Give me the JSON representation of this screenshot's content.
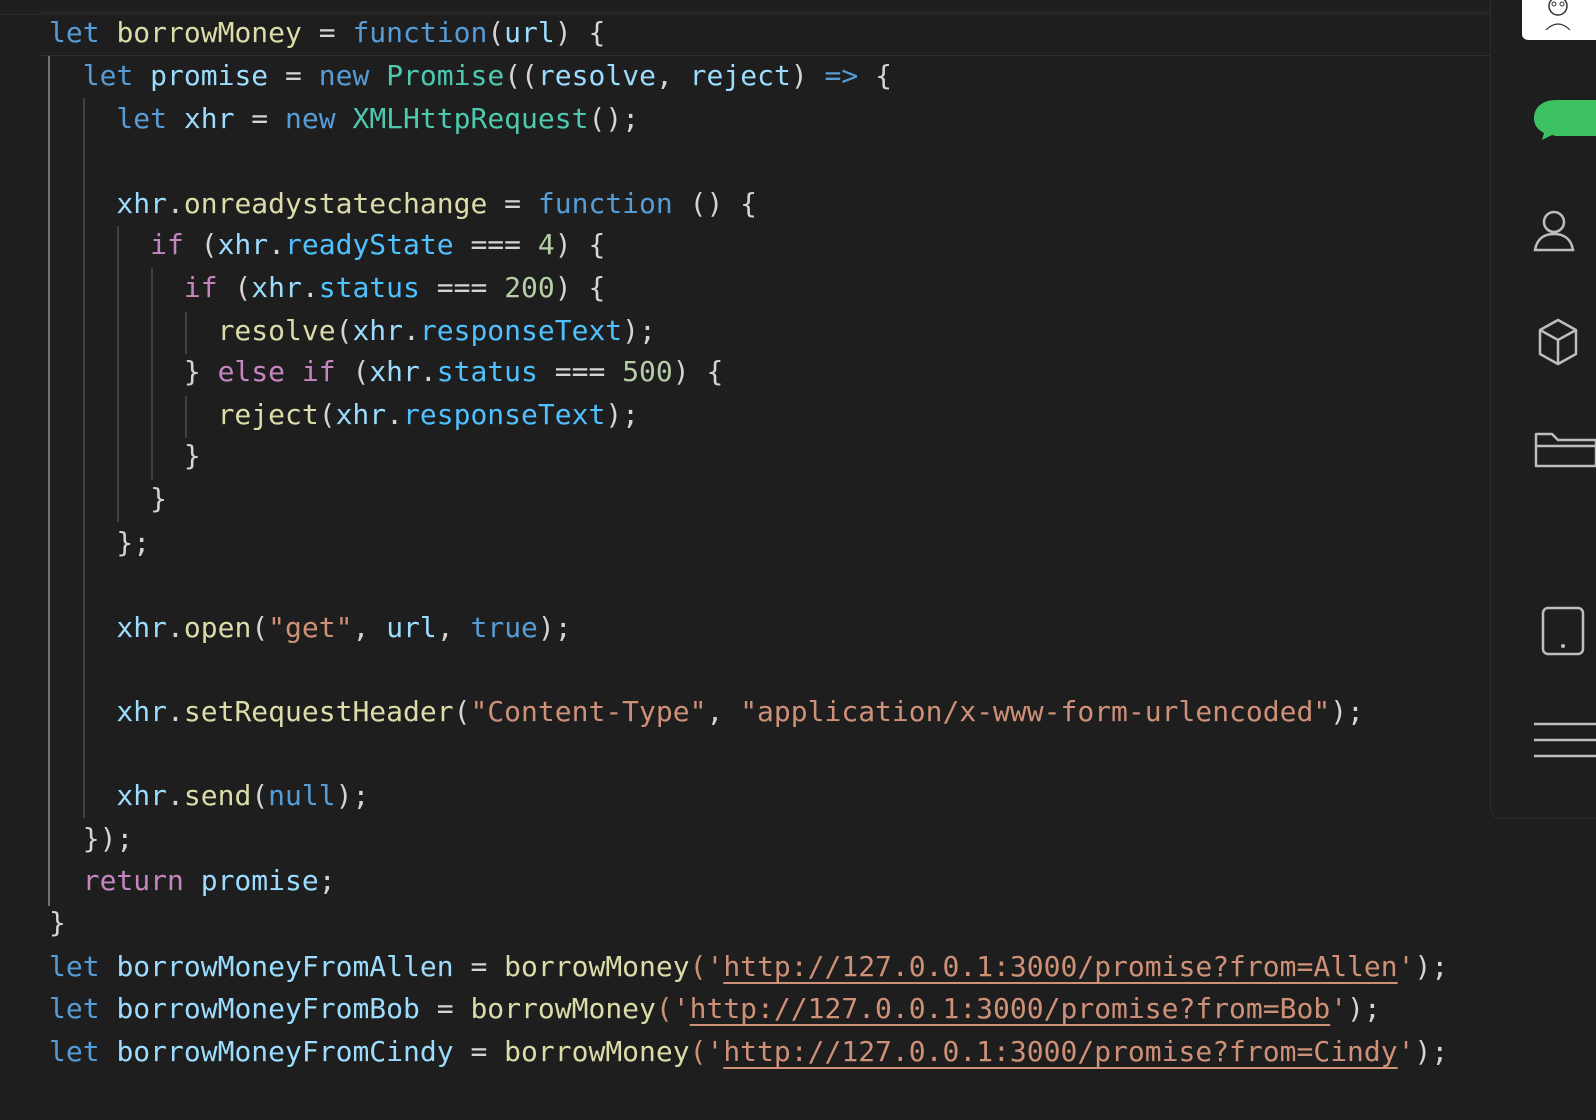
{
  "editor": {
    "lines": [
      [
        {
          "t": "let",
          "c": "kw"
        },
        {
          "t": " ",
          "c": "pun"
        },
        {
          "t": "borrowMoney",
          "c": "fn"
        },
        {
          "t": " = ",
          "c": "pun"
        },
        {
          "t": "function",
          "c": "kw"
        },
        {
          "t": "(",
          "c": "pun"
        },
        {
          "t": "url",
          "c": "var"
        },
        {
          "t": ") {",
          "c": "pun"
        }
      ],
      [
        {
          "t": "  let",
          "c": "kw"
        },
        {
          "t": " ",
          "c": "pun"
        },
        {
          "t": "promise",
          "c": "var"
        },
        {
          "t": " = ",
          "c": "pun"
        },
        {
          "t": "new",
          "c": "kw"
        },
        {
          "t": " ",
          "c": "pun"
        },
        {
          "t": "Promise",
          "c": "cls"
        },
        {
          "t": "((",
          "c": "pun"
        },
        {
          "t": "resolve",
          "c": "var"
        },
        {
          "t": ", ",
          "c": "pun"
        },
        {
          "t": "reject",
          "c": "var"
        },
        {
          "t": ") ",
          "c": "pun"
        },
        {
          "t": "=>",
          "c": "kw"
        },
        {
          "t": " {",
          "c": "pun"
        }
      ],
      [
        {
          "t": "    let",
          "c": "kw"
        },
        {
          "t": " ",
          "c": "pun"
        },
        {
          "t": "xhr",
          "c": "var"
        },
        {
          "t": " = ",
          "c": "pun"
        },
        {
          "t": "new",
          "c": "kw"
        },
        {
          "t": " ",
          "c": "pun"
        },
        {
          "t": "XMLHttpRequest",
          "c": "cls"
        },
        {
          "t": "();",
          "c": "pun"
        }
      ],
      [],
      [
        {
          "t": "    xhr",
          "c": "var"
        },
        {
          "t": ".",
          "c": "pun"
        },
        {
          "t": "onreadystatechange",
          "c": "fn"
        },
        {
          "t": " = ",
          "c": "pun"
        },
        {
          "t": "function",
          "c": "kw"
        },
        {
          "t": " () {",
          "c": "pun"
        }
      ],
      [
        {
          "t": "      if",
          "c": "ctrl"
        },
        {
          "t": " (",
          "c": "pun"
        },
        {
          "t": "xhr",
          "c": "var"
        },
        {
          "t": ".",
          "c": "pun"
        },
        {
          "t": "readyState",
          "c": "prop"
        },
        {
          "t": " === ",
          "c": "pun"
        },
        {
          "t": "4",
          "c": "num"
        },
        {
          "t": ") {",
          "c": "pun"
        }
      ],
      [
        {
          "t": "        if",
          "c": "ctrl"
        },
        {
          "t": " (",
          "c": "pun"
        },
        {
          "t": "xhr",
          "c": "var"
        },
        {
          "t": ".",
          "c": "pun"
        },
        {
          "t": "status",
          "c": "prop"
        },
        {
          "t": " === ",
          "c": "pun"
        },
        {
          "t": "200",
          "c": "num"
        },
        {
          "t": ") {",
          "c": "pun"
        }
      ],
      [
        {
          "t": "          resolve",
          "c": "fn"
        },
        {
          "t": "(",
          "c": "pun"
        },
        {
          "t": "xhr",
          "c": "var"
        },
        {
          "t": ".",
          "c": "pun"
        },
        {
          "t": "responseText",
          "c": "prop"
        },
        {
          "t": ");",
          "c": "pun"
        }
      ],
      [
        {
          "t": "        } ",
          "c": "pun"
        },
        {
          "t": "else",
          "c": "ctrl"
        },
        {
          "t": " ",
          "c": "pun"
        },
        {
          "t": "if",
          "c": "ctrl"
        },
        {
          "t": " (",
          "c": "pun"
        },
        {
          "t": "xhr",
          "c": "var"
        },
        {
          "t": ".",
          "c": "pun"
        },
        {
          "t": "status",
          "c": "prop"
        },
        {
          "t": " === ",
          "c": "pun"
        },
        {
          "t": "500",
          "c": "num"
        },
        {
          "t": ") {",
          "c": "pun"
        }
      ],
      [
        {
          "t": "          reject",
          "c": "fn"
        },
        {
          "t": "(",
          "c": "pun"
        },
        {
          "t": "xhr",
          "c": "var"
        },
        {
          "t": ".",
          "c": "pun"
        },
        {
          "t": "responseText",
          "c": "prop"
        },
        {
          "t": ");",
          "c": "pun"
        }
      ],
      [
        {
          "t": "        }",
          "c": "pun"
        }
      ],
      [
        {
          "t": "      }",
          "c": "pun"
        }
      ],
      [
        {
          "t": "    };",
          "c": "pun"
        }
      ],
      [],
      [
        {
          "t": "    xhr",
          "c": "var"
        },
        {
          "t": ".",
          "c": "pun"
        },
        {
          "t": "open",
          "c": "fn"
        },
        {
          "t": "(",
          "c": "pun"
        },
        {
          "t": "\"get\"",
          "c": "str"
        },
        {
          "t": ", ",
          "c": "pun"
        },
        {
          "t": "url",
          "c": "var"
        },
        {
          "t": ", ",
          "c": "pun"
        },
        {
          "t": "true",
          "c": "kw"
        },
        {
          "t": ");",
          "c": "pun"
        }
      ],
      [],
      [
        {
          "t": "    xhr",
          "c": "var"
        },
        {
          "t": ".",
          "c": "pun"
        },
        {
          "t": "setRequestHeader",
          "c": "fn"
        },
        {
          "t": "(",
          "c": "pun"
        },
        {
          "t": "\"Content-Type\"",
          "c": "str"
        },
        {
          "t": ", ",
          "c": "pun"
        },
        {
          "t": "\"application/x-www-form-urlencoded\"",
          "c": "str"
        },
        {
          "t": ");",
          "c": "pun"
        }
      ],
      [],
      [
        {
          "t": "    xhr",
          "c": "var"
        },
        {
          "t": ".",
          "c": "pun"
        },
        {
          "t": "send",
          "c": "fn"
        },
        {
          "t": "(",
          "c": "pun"
        },
        {
          "t": "null",
          "c": "kw"
        },
        {
          "t": ");",
          "c": "pun"
        }
      ],
      [
        {
          "t": "  });",
          "c": "pun"
        }
      ],
      [
        {
          "t": "  return",
          "c": "ctrl"
        },
        {
          "t": " ",
          "c": "pun"
        },
        {
          "t": "promise",
          "c": "var"
        },
        {
          "t": ";",
          "c": "pun"
        }
      ],
      [
        {
          "t": "}",
          "c": "pun"
        }
      ],
      [
        {
          "t": "let",
          "c": "kw"
        },
        {
          "t": " ",
          "c": "pun"
        },
        {
          "t": "borrowMoneyFromAllen",
          "c": "var"
        },
        {
          "t": " = ",
          "c": "pun"
        },
        {
          "t": "borrowMoney",
          "c": "fn"
        },
        {
          "t": "('",
          "c": "str"
        },
        {
          "t": "http://127.0.0.1:3000/promise?from=Allen",
          "c": "str link"
        },
        {
          "t": "'",
          "c": "str"
        },
        {
          "t": ");",
          "c": "pun"
        }
      ],
      [
        {
          "t": "let",
          "c": "kw"
        },
        {
          "t": " ",
          "c": "pun"
        },
        {
          "t": "borrowMoneyFromBob",
          "c": "var"
        },
        {
          "t": " = ",
          "c": "pun"
        },
        {
          "t": "borrowMoney",
          "c": "fn"
        },
        {
          "t": "('",
          "c": "str"
        },
        {
          "t": "http://127.0.0.1:3000/promise?from=Bob",
          "c": "str link"
        },
        {
          "t": "'",
          "c": "str"
        },
        {
          "t": ");",
          "c": "pun"
        }
      ],
      [
        {
          "t": "let",
          "c": "kw"
        },
        {
          "t": " ",
          "c": "pun"
        },
        {
          "t": "borrowMoneyFromCindy",
          "c": "var"
        },
        {
          "t": " = ",
          "c": "pun"
        },
        {
          "t": "borrowMoney",
          "c": "fn"
        },
        {
          "t": "('",
          "c": "str"
        },
        {
          "t": "http://127.0.0.1:3000/promise?from=Cindy",
          "c": "str link"
        },
        {
          "t": "'",
          "c": "str"
        },
        {
          "t": ");",
          "c": "pun"
        }
      ]
    ]
  },
  "right_panel": {
    "icons": [
      "avatar",
      "chat-icon",
      "contacts-icon",
      "box-icon",
      "folder-icon",
      "phone-icon",
      "menu-icon"
    ]
  },
  "colors": {
    "background": "#1e1e1e",
    "keyword": "#569cd6",
    "control": "#c586c0",
    "function": "#dcdcaa",
    "variable": "#9cdcfe",
    "property": "#4fc1ff",
    "class": "#4ec9b0",
    "string": "#ce9178",
    "number": "#b5cea8",
    "chat_green": "#3cc262"
  }
}
